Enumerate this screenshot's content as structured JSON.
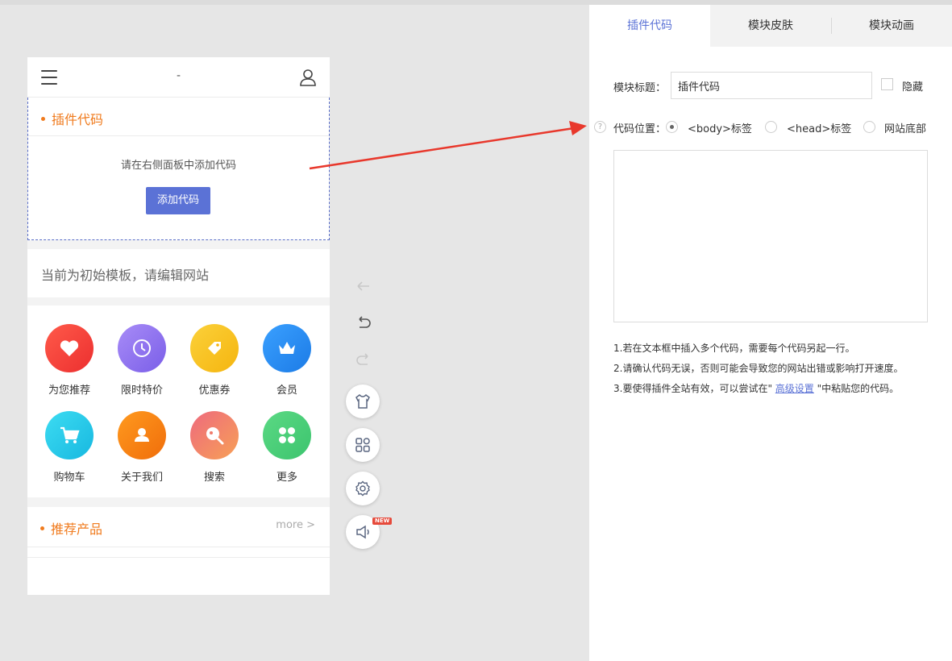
{
  "phone": {
    "header_title": "-",
    "plugin_section_title": "插件代码",
    "plugin_hint": "请在右侧面板中添加代码",
    "add_code_button": "添加代码",
    "notice_text": "当前为初始模板，请编辑网站",
    "grid_items": [
      {
        "label": "为您推荐",
        "icon": "heart-icon",
        "color": "#f03c3c"
      },
      {
        "label": "限时特价",
        "icon": "clock-icon",
        "color": "#8c6cf0"
      },
      {
        "label": "优惠券",
        "icon": "tag-icon",
        "color": "#f7c21b"
      },
      {
        "label": "会员",
        "icon": "crown-icon",
        "color": "#2e8cf0"
      },
      {
        "label": "购物车",
        "icon": "cart-icon",
        "color": "#23c7e6"
      },
      {
        "label": "关于我们",
        "icon": "person-icon",
        "color": "#fa8214"
      },
      {
        "label": "搜索",
        "icon": "search-icon",
        "color": "#f07a6a"
      },
      {
        "label": "更多",
        "icon": "apps-icon",
        "color": "#4dd07c"
      }
    ],
    "products_title": "推荐产品",
    "more_link": "more >"
  },
  "tools": {
    "back": "arrow-left-icon",
    "undo": "undo-icon",
    "redo": "redo-icon",
    "skin": "shirt-icon",
    "modules": "grid-icon",
    "settings": "gear-icon",
    "announce": "speaker-icon",
    "new_badge": "NEW"
  },
  "panel": {
    "tabs": [
      {
        "label": "插件代码",
        "active": true
      },
      {
        "label": "模块皮肤",
        "active": false
      },
      {
        "label": "模块动画",
        "active": false
      }
    ],
    "title_label": "模块标题：",
    "title_value": "插件代码",
    "hide_label": "隐藏",
    "help_mark": "?",
    "position_label": "代码位置：",
    "position_options": [
      {
        "label": "<body>标签",
        "checked": true
      },
      {
        "label": "<head>标签",
        "checked": false
      },
      {
        "label": "网站底部",
        "checked": false
      }
    ],
    "code_value": "",
    "tips": [
      "1.若在文本框中插入多个代码，需要每个代码另起一行。",
      "2.请确认代码无误，否则可能会导致您的网站出错或影响打开速度。"
    ],
    "tip3_before": "3.要使得插件全站有效，可以尝试在\" ",
    "tip3_link": "高级设置",
    "tip3_after": " \"中粘贴您的代码。"
  },
  "colors": {
    "accent": "#5b72d6",
    "section_title": "#f07b1e",
    "arrow": "#e8382c"
  }
}
